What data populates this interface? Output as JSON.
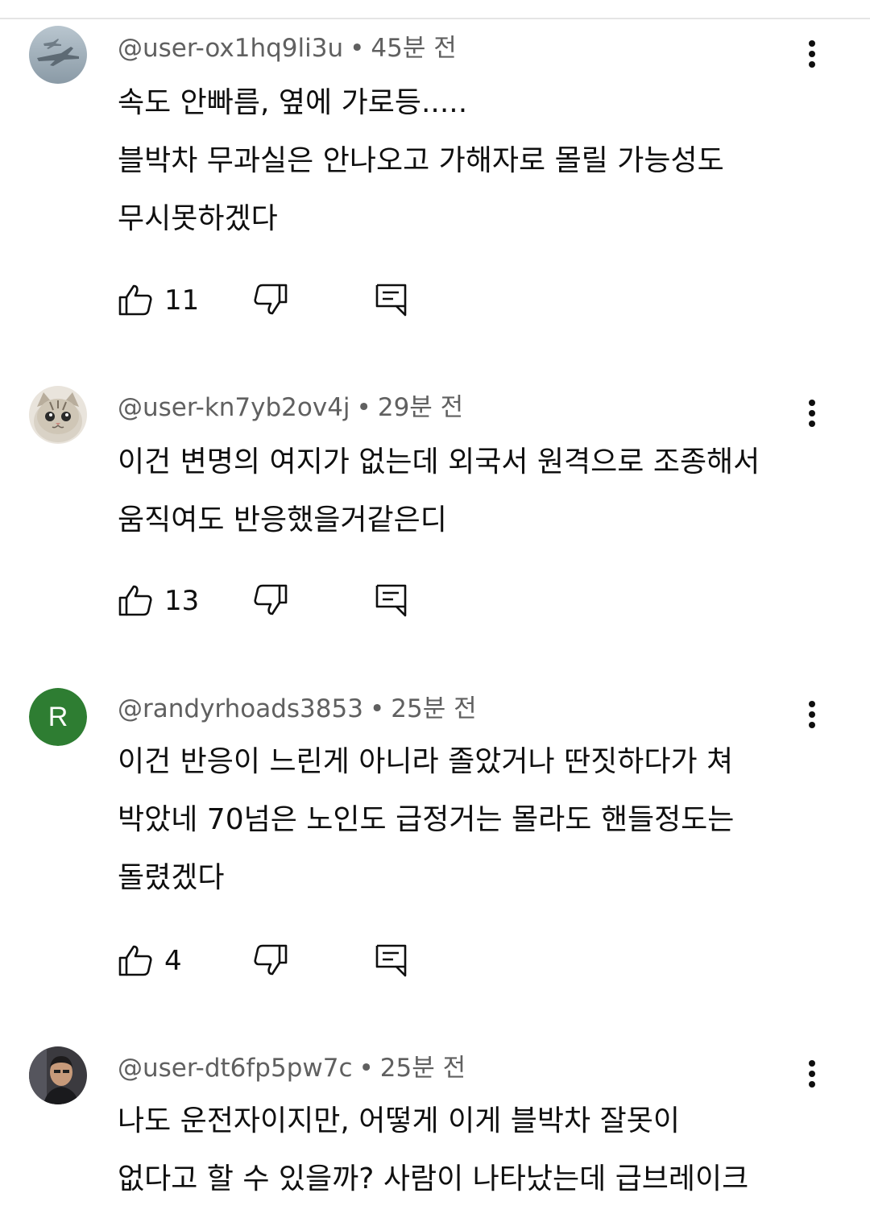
{
  "comments": [
    {
      "author": "@user-ox1hq9li3u",
      "time": "45분 전",
      "avatar_icon": "fighter-jet-avatar",
      "lines": [
        "속도 안빠름, 옆에 가로등.....",
        "블박차 무과실은 안나오고 가해자로 몰릴 가능성도",
        "무시못하겠다"
      ],
      "likes": "11"
    },
    {
      "author": "@user-kn7yb2ov4j",
      "time": "29분 전",
      "avatar_icon": "cat-avatar",
      "lines": [
        "이건 변명의 여지가 없는데 외국서 원격으로 조종해서",
        "움직여도 반응했을거같은디"
      ],
      "likes": "13"
    },
    {
      "author": "@randyrhoads3853",
      "time": "25분 전",
      "avatar_icon": "letter-avatar",
      "avatar_letter": "R",
      "avatar_color": "#2e7d32",
      "lines": [
        "이건 반응이 느린게 아니라 졸았거나 딴짓하다가 쳐",
        "박았네 70넘은 노인도 급정거는 몰라도 핸들정도는",
        "돌렸겠다"
      ],
      "likes": "4"
    },
    {
      "author": "@user-dt6fp5pw7c",
      "time": "25분 전",
      "avatar_icon": "person-photo-avatar",
      "lines": [
        "나도 운전자이지만, 어떻게 이게 블박차 잘못이",
        "없다고 할 수 있을까? 사람이 나타났는데 급브레이크"
      ],
      "likes": ""
    }
  ],
  "colors": {
    "text": "#0f0f0f",
    "meta": "#606060",
    "divider": "#e5e5e5"
  }
}
